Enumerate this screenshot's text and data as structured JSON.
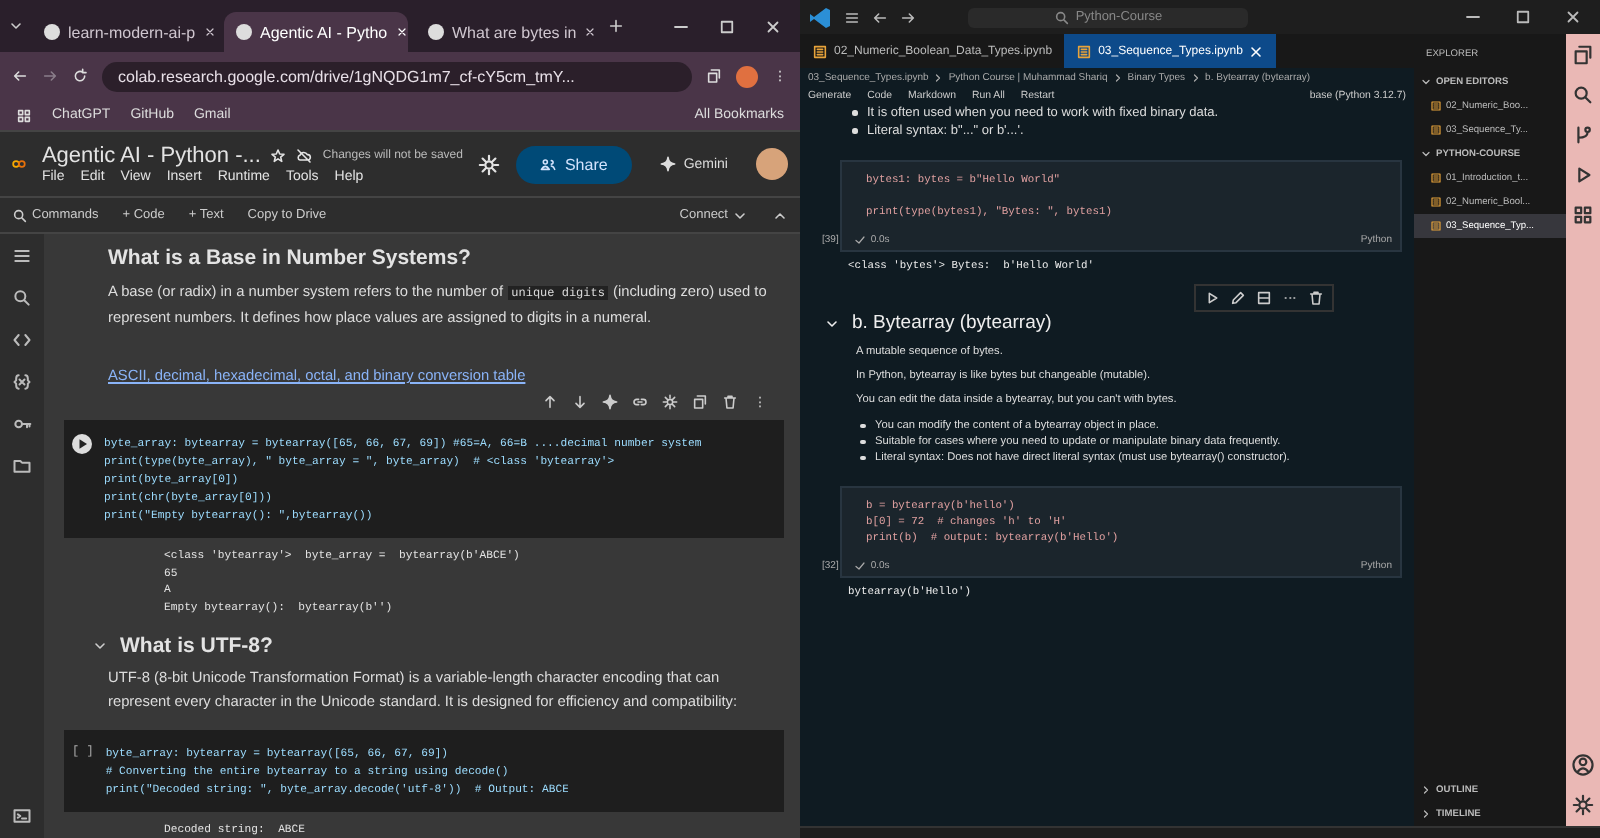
{
  "browser": {
    "tabs": [
      {
        "label": "learn-modern-ai-p",
        "selected": false
      },
      {
        "label": "Agentic AI - Pytho",
        "selected": true
      },
      {
        "label": "What are bytes in",
        "selected": false
      }
    ],
    "address": "colab.research.google.com/drive/1gNQDG1m7_cf-cY5cm_tmY...",
    "bookmarks": [
      "ChatGPT",
      "GitHub",
      "Gmail"
    ],
    "all_bookmarks": "All Bookmarks"
  },
  "colab": {
    "title": "Agentic AI - Python -...",
    "save_status": "Changes will not be saved",
    "menu": [
      "File",
      "Edit",
      "View",
      "Insert",
      "Runtime",
      "Tools",
      "Help"
    ],
    "share": "Share",
    "gemini": "Gemini",
    "toolbar": {
      "commands": "Commands",
      "code": "+ Code",
      "text": "+ Text",
      "copy": "Copy to Drive",
      "connect": "Connect"
    },
    "heading1": "What is a Base in Number Systems?",
    "para1": {
      "before": "A base (or radix) in a number system refers to the number of",
      "code": "unique digits",
      "after": "(including zero) used to represent numbers. It defines how place values are assigned to digits in a numeral."
    },
    "link": "ASCII, decimal, hexadecimal, octal, and binary conversion table",
    "cell1": {
      "lines": [
        "byte_array: bytearray = bytearray([65, 66, 67, 69]) #65=A, 66=B ....decimal number system",
        "print(type(byte_array), \" byte_array = \", byte_array)  # <class 'bytearray'>",
        "print(byte_array[0])",
        "print(chr(byte_array[0]))",
        "print(\"Empty bytearray(): \",bytearray())"
      ],
      "output": [
        "<class 'bytearray'>  byte_array =  bytearray(b'ABCE')",
        "65",
        "A",
        "Empty bytearray():  bytearray(b'')"
      ]
    },
    "heading2": "What is UTF-8?",
    "para2": "UTF-8 (8-bit Unicode Transformation Format) is a variable-length character encoding that can represent every character in the Unicode standard. It is designed for efficiency and compatibility:",
    "cell2": {
      "prompt": "[ ]",
      "lines": [
        "byte_array: bytearray = bytearray([65, 66, 67, 69])",
        "# Converting the entire bytearray to a string using decode()",
        "print(\"Decoded string: \", byte_array.decode('utf-8'))  # Output: ABCE"
      ],
      "output": [
        "Decoded string:  ABCE"
      ]
    }
  },
  "vscode": {
    "search": "Python-Course",
    "tabs": [
      {
        "label": "02_Numeric_Boolean_Data_Types.ipynb",
        "selected": false
      },
      {
        "label": "03_Sequence_Types.ipynb",
        "selected": true
      }
    ],
    "breadcrumb": [
      "03_Sequence_Types.ipynb",
      "Python Course | Muhammad Shariq",
      "Binary Types",
      "b. Bytearray (bytearray)"
    ],
    "toolbar": [
      "Generate",
      "Code",
      "Markdown",
      "Run All",
      "Restart"
    ],
    "kernel": "base (Python 3.12.7)",
    "top_bullets": [
      "It is often used when you need to work with fixed binary data.",
      "Literal syntax: b\"...\" or b'...'."
    ],
    "cell1": {
      "blocks": [
        [
          "bytes1: bytes = b\"Hello World\""
        ],
        [
          "print(type(bytes1), \"Bytes: \", bytes1)"
        ]
      ],
      "count": "[39]",
      "time": "0.0s",
      "lang": "Python",
      "output": "<class 'bytes'> Bytes:  b'Hello World'"
    },
    "heading": "b. Bytearray (bytearray)",
    "paras": [
      "A mutable sequence of bytes.",
      "In Python, bytearray is like bytes but changeable (mutable).",
      "You can edit the data inside a bytearray, but you can't with bytes."
    ],
    "bullets": [
      "You can modify the content of a bytearray object in place.",
      "Suitable for cases where you need to update or manipulate binary data frequently.",
      "Literal syntax: Does not have direct literal syntax (must use bytearray() constructor)."
    ],
    "cell2": {
      "blocks": [
        [
          "b = bytearray(b'hello')",
          "b[0] = 72  # changes 'h' to 'H'",
          "print(b)  # output: bytearray(b'Hello')"
        ]
      ],
      "count": "[32]",
      "time": "0.0s",
      "lang": "Python",
      "output": "bytearray(b'Hello')"
    },
    "explorer": {
      "title": "EXPLORER",
      "open_editors": "OPEN EDITORS",
      "open_files": [
        {
          "label": "02_Numeric_Boo...",
          "selected": false
        },
        {
          "label": "03_Sequence_Ty...",
          "selected": false
        }
      ],
      "folder": "PYTHON-COURSE",
      "files": [
        {
          "label": "01_Introduction_t...",
          "selected": false
        },
        {
          "label": "02_Numeric_Bool...",
          "selected": false
        },
        {
          "label": "03_Sequence_Typ...",
          "selected": true
        }
      ],
      "outline": "OUTLINE",
      "timeline": "TIMELINE"
    }
  }
}
